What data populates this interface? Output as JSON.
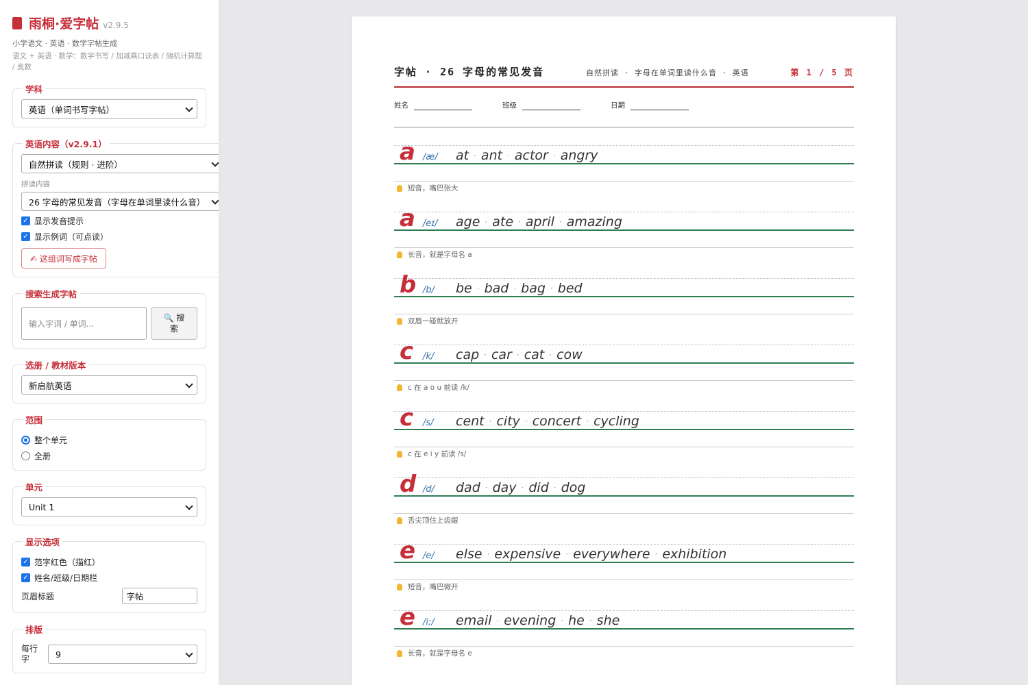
{
  "brand": {
    "title": "雨桐·爱字帖",
    "version": "v2.9.5",
    "subtitle": "小学语文 · 英语 · 数学字帖生成",
    "desc": "语文 + 英语 · 数学：数字书写 / 加减乘口诀表 / 随机计算题 / 奥数"
  },
  "subject": {
    "legend": "学科",
    "value": "英语（单词书写字帖）"
  },
  "english": {
    "legend": "英语内容（v2.9.1）",
    "mode": "自然拼读（规则 · 进阶）",
    "content_label": "拼读内容",
    "content": "26 字母的常见发音（字母在单词里读什么音）",
    "show_phonics": "显示发音提示",
    "show_examples": "显示例词（可点读）",
    "make_button": "✍ 这组词写成字帖"
  },
  "search": {
    "legend": "搜索生成字帖",
    "placeholder": "输入字词 / 单词...",
    "button_line1": "🔍 搜",
    "button_line2": "索"
  },
  "textbook": {
    "legend": "选册 / 教材版本",
    "value": "新启航英语"
  },
  "range": {
    "legend": "范围",
    "opt1": "整个单元",
    "opt2": "全册"
  },
  "unit": {
    "legend": "单元",
    "value": "Unit 1"
  },
  "display": {
    "legend": "显示选项",
    "opt1": "范字红色（描红）",
    "opt2": "姓名/班级/日期栏",
    "header_label": "页眉标题",
    "header_value": "字帖"
  },
  "layout": {
    "legend": "排版",
    "per_row_label": "每行字",
    "per_row_value": "9"
  },
  "sheet": {
    "title": "字帖 · 26 字母的常见发音",
    "meta": "自然拼读 · 字母在单词里读什么音 · 英语",
    "page": "第 1 / 5 页",
    "name_label": "姓名",
    "class_label": "班级",
    "date_label": "日期"
  },
  "entries": [
    {
      "letter": "a",
      "ipa": "/æ/",
      "words": [
        "at",
        "ant",
        "actor",
        "angry"
      ],
      "hint": "短音，嘴巴张大"
    },
    {
      "letter": "a",
      "ipa": "/eɪ/",
      "words": [
        "age",
        "ate",
        "april",
        "amazing"
      ],
      "hint": "长音，就是字母名 a"
    },
    {
      "letter": "b",
      "ipa": "/b/",
      "words": [
        "be",
        "bad",
        "bag",
        "bed"
      ],
      "hint": "双唇一碰就放开"
    },
    {
      "letter": "c",
      "ipa": "/k/",
      "words": [
        "cap",
        "car",
        "cat",
        "cow"
      ],
      "hint": "c 在 a o u 前读 /k/"
    },
    {
      "letter": "c",
      "ipa": "/s/",
      "words": [
        "cent",
        "city",
        "concert",
        "cycling"
      ],
      "hint": "c 在 e i y 前读 /s/"
    },
    {
      "letter": "d",
      "ipa": "/d/",
      "words": [
        "dad",
        "day",
        "did",
        "dog"
      ],
      "hint": "舌尖顶住上齿龈"
    },
    {
      "letter": "e",
      "ipa": "/e/",
      "words": [
        "else",
        "expensive",
        "everywhere",
        "exhibition"
      ],
      "hint": "短音，嘴巴微开"
    },
    {
      "letter": "e",
      "ipa": "/iː/",
      "words": [
        "email",
        "evening",
        "he",
        "she"
      ],
      "hint": "长音，就是字母名 e"
    }
  ]
}
